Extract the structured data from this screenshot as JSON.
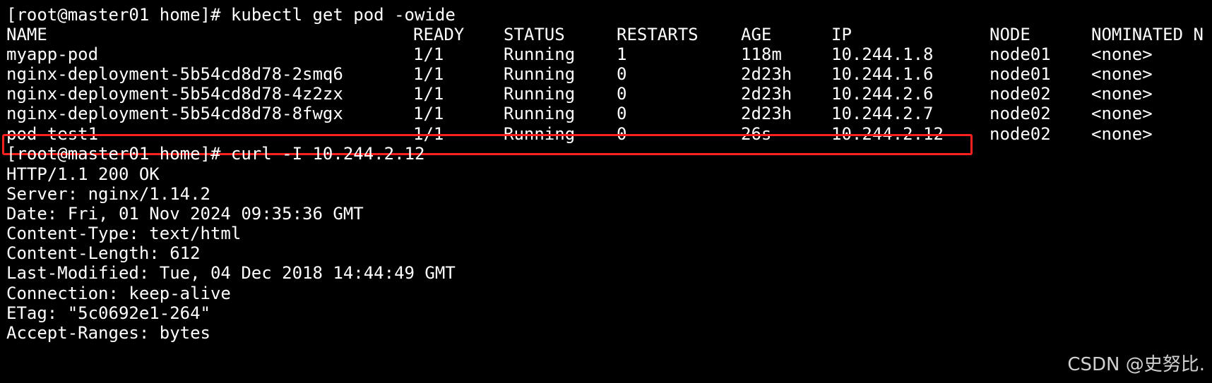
{
  "terminal": {
    "prompt_1": "[root@master01 home]# kubectl get pod -owide",
    "table": {
      "headers": {
        "name": "NAME",
        "ready": "READY",
        "status": "STATUS",
        "restarts": "RESTARTS",
        "age": "AGE",
        "ip": "IP",
        "node": "NODE",
        "nominated": "NOMINATED N"
      },
      "rows": [
        {
          "name": "myapp-pod",
          "ready": "1/1",
          "status": "Running",
          "restarts": "1",
          "age": "118m",
          "ip": "10.244.1.8",
          "node": "node01",
          "nominated": "<none>"
        },
        {
          "name": "nginx-deployment-5b54cd8d78-2smq6",
          "ready": "1/1",
          "status": "Running",
          "restarts": "0",
          "age": "2d23h",
          "ip": "10.244.1.6",
          "node": "node01",
          "nominated": "<none>"
        },
        {
          "name": "nginx-deployment-5b54cd8d78-4z2zx",
          "ready": "1/1",
          "status": "Running",
          "restarts": "0",
          "age": "2d23h",
          "ip": "10.244.2.6",
          "node": "node02",
          "nominated": "<none>"
        },
        {
          "name": "nginx-deployment-5b54cd8d78-8fwgx",
          "ready": "1/1",
          "status": "Running",
          "restarts": "0",
          "age": "2d23h",
          "ip": "10.244.2.7",
          "node": "node02",
          "nominated": "<none>"
        },
        {
          "name": "pod-test1",
          "ready": "1/1",
          "status": "Running",
          "restarts": "0",
          "age": "26s",
          "ip": "10.244.2.12",
          "node": "node02",
          "nominated": "<none>"
        }
      ]
    },
    "prompt_2": "[root@master01 home]# curl -I 10.244.2.12",
    "response": [
      "HTTP/1.1 200 OK",
      "Server: nginx/1.14.2",
      "Date: Fri, 01 Nov 2024 09:35:36 GMT",
      "Content-Type: text/html",
      "Content-Length: 612",
      "Last-Modified: Tue, 04 Dec 2018 14:44:49 GMT",
      "Connection: keep-alive",
      "ETag: \"5c0692e1-264\"",
      "Accept-Ranges: bytes"
    ],
    "highlight_color": "#ff2020",
    "background_color": "#000000",
    "text_color": "#ffffff"
  },
  "watermark": "CSDN @史努比."
}
